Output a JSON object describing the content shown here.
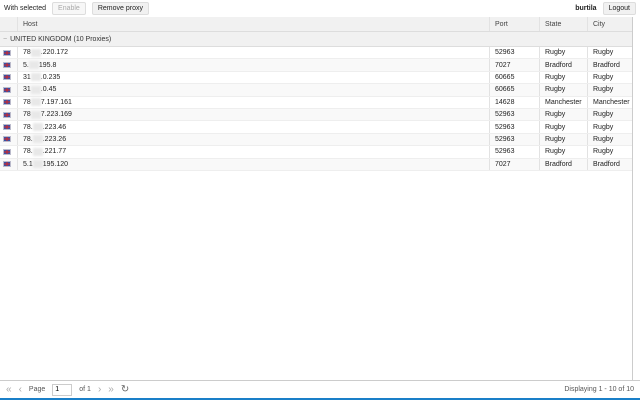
{
  "toolbar": {
    "with_selected": "With selected",
    "enable": "Enable",
    "remove_proxy": "Remove proxy",
    "user": "burtila",
    "logout": "Logout"
  },
  "columns": {
    "host": "Host",
    "port": "Port",
    "state": "State",
    "city": "City"
  },
  "group": {
    "label": "UNITED KINGDOM (10 Proxies)",
    "icon": "collapse-minus-icon"
  },
  "rows": [
    {
      "host_a": "78",
      "host_b": ".220.172",
      "port": "52963",
      "state": "Rugby",
      "city": "Rugby"
    },
    {
      "host_a": "5.",
      "host_b": "195.8",
      "port": "7027",
      "state": "Bradford",
      "city": "Bradford"
    },
    {
      "host_a": "31",
      "host_b": ".0.235",
      "port": "60665",
      "state": "Rugby",
      "city": "Rugby"
    },
    {
      "host_a": "31",
      "host_b": ".0.45",
      "port": "60665",
      "state": "Rugby",
      "city": "Rugby"
    },
    {
      "host_a": "78",
      "host_b": "7.197.161",
      "port": "14628",
      "state": "Manchester",
      "city": "Manchester"
    },
    {
      "host_a": "78",
      "host_b": "7.223.169",
      "port": "52963",
      "state": "Rugby",
      "city": "Rugby"
    },
    {
      "host_a": "78.",
      "host_b": ".223.46",
      "port": "52963",
      "state": "Rugby",
      "city": "Rugby"
    },
    {
      "host_a": "78.",
      "host_b": ".223.26",
      "port": "52963",
      "state": "Rugby",
      "city": "Rugby"
    },
    {
      "host_a": "78.",
      "host_b": ".221.77",
      "port": "52963",
      "state": "Rugby",
      "city": "Rugby"
    },
    {
      "host_a": "5.1",
      "host_b": "195.120",
      "port": "7027",
      "state": "Bradford",
      "city": "Bradford"
    }
  ],
  "footer": {
    "page_label": "Page",
    "page_value": "1",
    "of": "of 1",
    "displaying": "Displaying 1 - 10 of 10"
  },
  "colors": {
    "accent": "#1a7fc8"
  }
}
